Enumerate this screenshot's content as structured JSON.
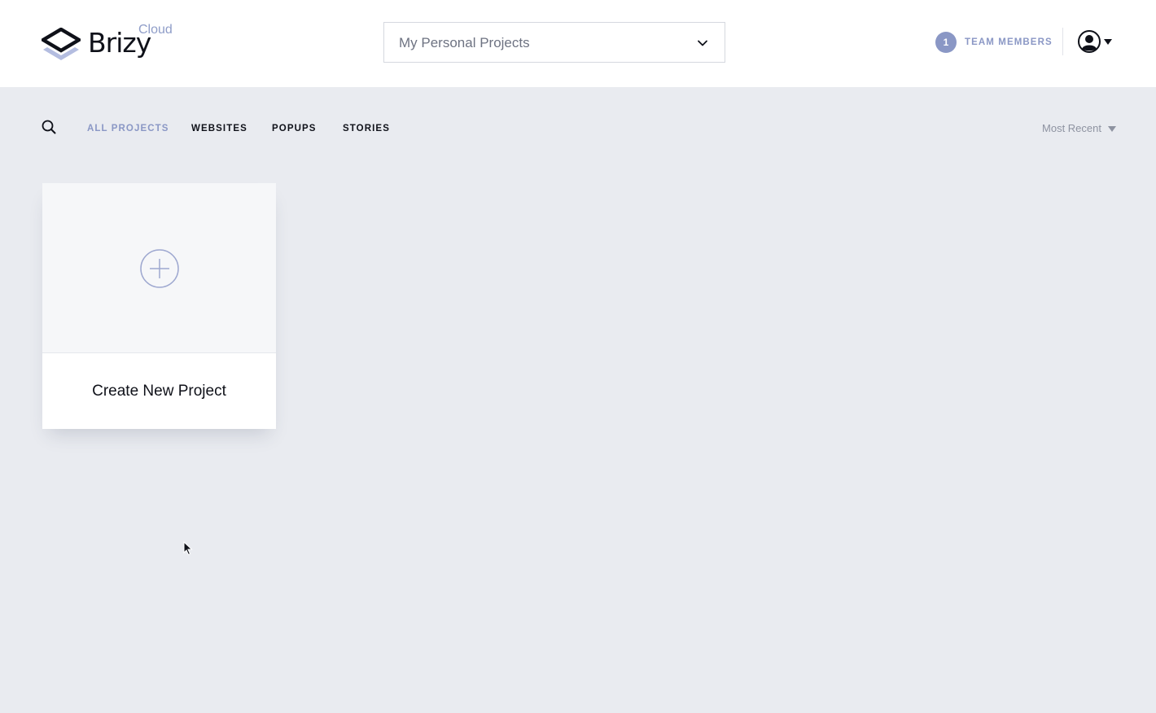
{
  "brand": {
    "name": "Brizy",
    "subname": "Cloud",
    "logo_icon": "layers-logo-icon",
    "accent_color": "#8a97c5"
  },
  "header": {
    "project_select": {
      "value": "My Personal Projects",
      "icon": "chevron-down-icon"
    },
    "team": {
      "count": "1",
      "label": "TEAM MEMBERS"
    },
    "account": {
      "icon": "user-avatar-icon",
      "caret": "caret-down-icon"
    }
  },
  "filters": {
    "search_icon": "search-icon",
    "tabs": [
      {
        "label": "ALL PROJECTS",
        "active": true
      },
      {
        "label": "WEBSITES",
        "active": false
      },
      {
        "label": "POPUPS",
        "active": false
      },
      {
        "label": "STORIES",
        "active": false
      }
    ],
    "sort": {
      "value": "Most Recent",
      "icon": "caret-down-icon"
    }
  },
  "cards": [
    {
      "label": "Create New Project",
      "icon": "plus-circle-icon"
    }
  ]
}
